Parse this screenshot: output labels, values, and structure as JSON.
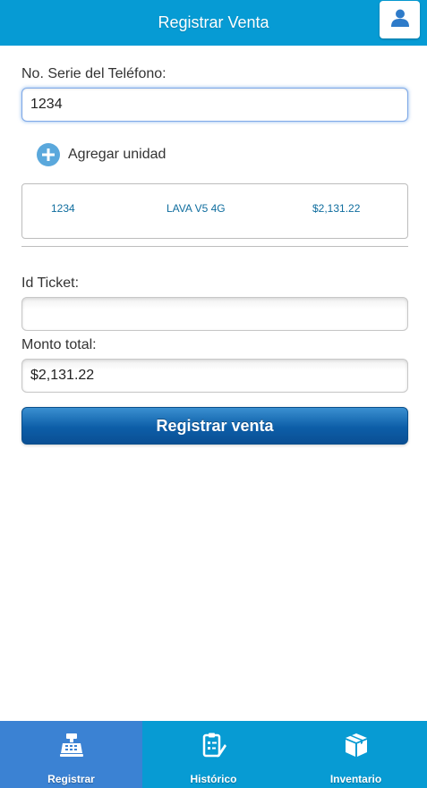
{
  "header": {
    "title": "Registrar Venta",
    "user_icon": "user-icon"
  },
  "form": {
    "serie_label": "No. Serie del Teléfono:",
    "serie_value": "1234",
    "add_unit_label": "Agregar unidad",
    "units": [
      {
        "serie": "1234",
        "modelo": "LAVA V5 4G",
        "precio": "$2,131.22"
      }
    ],
    "ticket_label": "Id Ticket:",
    "ticket_value": "",
    "monto_label": "Monto total:",
    "monto_value": "$2,131.22",
    "submit_label": "Registrar venta"
  },
  "nav": {
    "items": [
      {
        "label": "Registrar",
        "icon": "cash-register-icon",
        "active": true
      },
      {
        "label": "Histórico",
        "icon": "clipboard-edit-icon",
        "active": false
      },
      {
        "label": "Inventario",
        "icon": "box-icon",
        "active": false
      }
    ]
  },
  "colors": {
    "header_bg": "#069bd4",
    "nav_bg": "#079bd3",
    "nav_active_bg": "#3b82d3",
    "submit_bg": "#0d5ea8",
    "unit_text": "#0f6d9e"
  }
}
